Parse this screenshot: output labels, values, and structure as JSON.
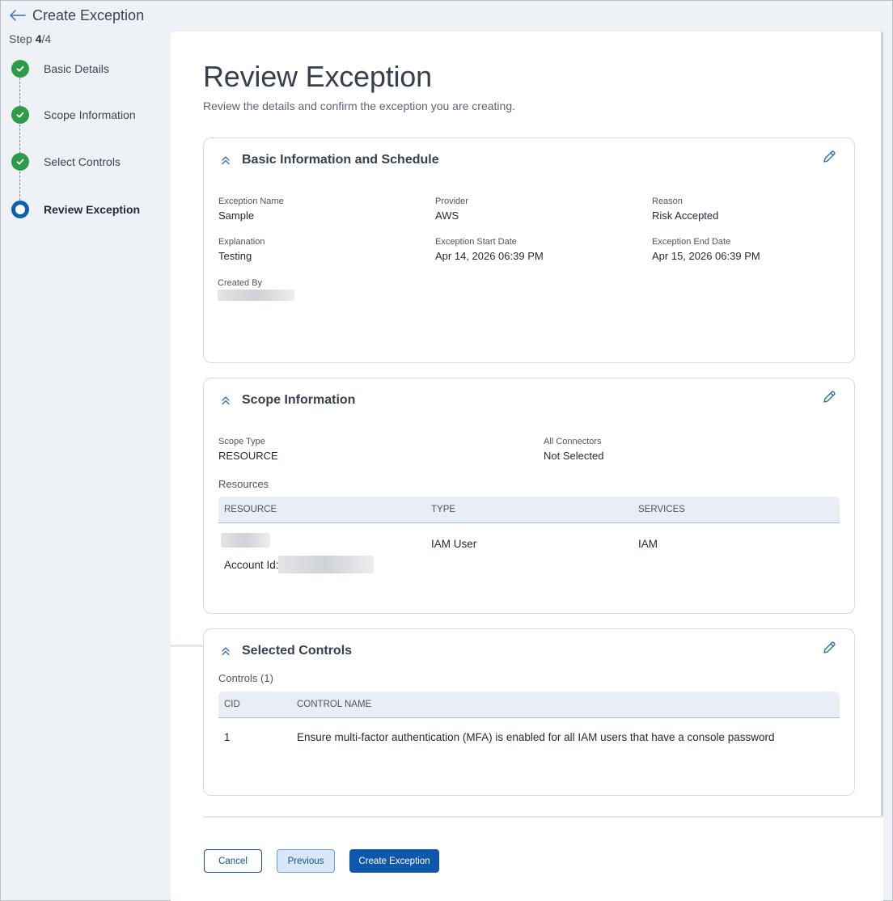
{
  "header": {
    "title": "Create Exception",
    "step_prefix": "Step ",
    "step_current": "4",
    "step_total": "/4"
  },
  "stepper": {
    "steps": [
      {
        "label": "Basic Details",
        "status": "done"
      },
      {
        "label": "Scope Information",
        "status": "done"
      },
      {
        "label": "Select Controls",
        "status": "done"
      },
      {
        "label": "Review Exception",
        "status": "current"
      }
    ]
  },
  "main": {
    "title": "Review Exception",
    "subtitle": "Review the details and confirm the exception you are creating."
  },
  "basic_info": {
    "title": "Basic Information and Schedule",
    "fields": {
      "exception_name": {
        "label": "Exception Name",
        "value": "Sample"
      },
      "provider": {
        "label": "Provider",
        "value": "AWS"
      },
      "reason": {
        "label": "Reason",
        "value": "Risk Accepted"
      },
      "explanation": {
        "label": "Explanation",
        "value": "Testing"
      },
      "start_date": {
        "label": "Exception Start Date",
        "value": "Apr 14, 2026 06:39 PM"
      },
      "end_date": {
        "label": "Exception End Date",
        "value": "Apr 15, 2026 06:39 PM"
      },
      "created_by": {
        "label": "Created By",
        "value": ""
      }
    }
  },
  "scope_info": {
    "title": "Scope Information",
    "scope_type": {
      "label": "Scope Type",
      "value": "RESOURCE"
    },
    "all_connectors": {
      "label": "All Connectors",
      "value": "Not Selected"
    },
    "resources_label": "Resources",
    "columns": [
      "RESOURCE",
      "TYPE",
      "SERVICES"
    ],
    "rows": [
      {
        "resource": "",
        "account_prefix": "Account Id:",
        "type": "IAM User",
        "services": "IAM"
      }
    ]
  },
  "selected_controls": {
    "title": "Selected Controls",
    "controls_label": "Controls (1)",
    "columns": [
      "CID",
      "CONTROL NAME"
    ],
    "rows": [
      {
        "cid": "1",
        "name": "Ensure multi-factor authentication (MFA) is enabled for all IAM users that have a console password"
      }
    ]
  },
  "buttons": {
    "cancel": "Cancel",
    "previous": "Previous",
    "create": "Create Exception"
  },
  "colors": {
    "primary": "#0f57ad",
    "success": "#2e9b47",
    "background": "#eef2f7"
  },
  "icons": {
    "back": "arrow-left-icon",
    "done": "check-icon",
    "collapse": "chevrons-up-icon",
    "edit": "pencil-icon"
  }
}
